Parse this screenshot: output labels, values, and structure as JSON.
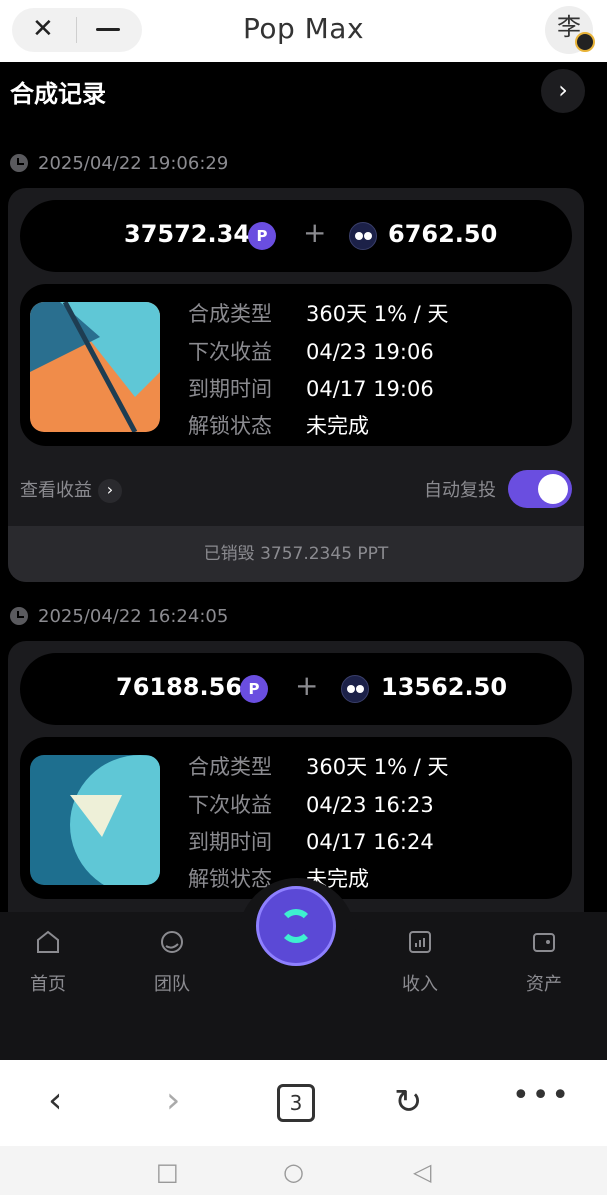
{
  "browser": {
    "title": "Pop Max",
    "avatar_char": "李",
    "tab_count": "3"
  },
  "page": {
    "title": "合成记录"
  },
  "records": [
    {
      "time": "2025/04/22 19:06:29",
      "amount_ppt": "37572.34",
      "amount_other": "6762.50",
      "labels": {
        "type": "合成类型",
        "next": "下次收益",
        "expire": "到期时间",
        "unlock": "解锁状态"
      },
      "type": "360天 1% / 天",
      "next": "04/23 19:06",
      "expire": "04/17 19:06",
      "unlock": "未完成",
      "view_income": "查看收益",
      "auto_reinvest": "自动复投",
      "burned": "已销毁 3757.2345 PPT"
    },
    {
      "time": "2025/04/22 16:24:05",
      "amount_ppt": "76188.56",
      "amount_other": "13562.50",
      "labels": {
        "type": "合成类型",
        "next": "下次收益",
        "expire": "到期时间",
        "unlock": "解锁状态"
      },
      "type": "360天 1% / 天",
      "next": "04/23 16:23",
      "expire": "04/17 16:24",
      "unlock": "未完成"
    }
  ],
  "nav": {
    "home": "首页",
    "team": "团队",
    "income": "收入",
    "assets": "资产"
  },
  "colors": {
    "accent": "#6a4ee0",
    "center_ring": "#3ef0d0"
  }
}
